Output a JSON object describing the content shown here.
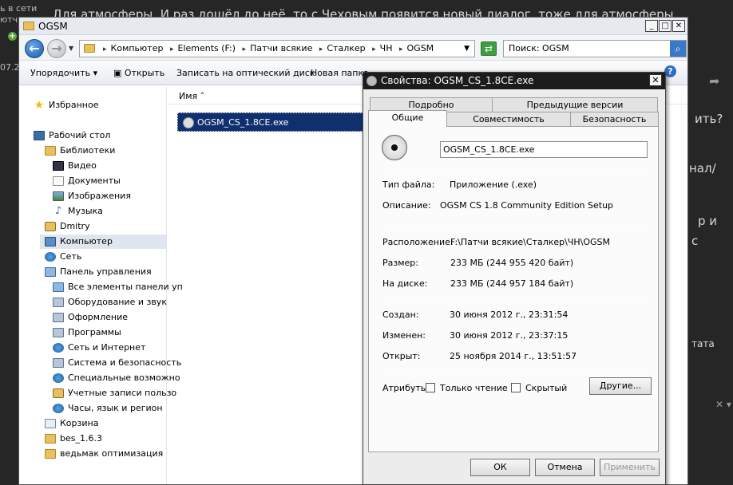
{
  "background": {
    "title": "Для атмосферы. И раз дошёл до неё, то с Чеховым появится новый диалог, тоже для атмосферы",
    "left_line1": "ь в сети",
    "left_line2": "ютч",
    "left_line3": "07.2",
    "right_line1": "ить?",
    "right_line2": "нал/",
    "right_line3": "р и",
    "right_line4": "с",
    "right_line5": "тата"
  },
  "explorer": {
    "title": "OGSM",
    "breadcrumbs": [
      "Компьютер",
      "Elements (F:)",
      "Патчи всякие",
      "Сталкер",
      "ЧН",
      "OGSM"
    ],
    "search_placeholder": "Поиск: OGSM",
    "toolbar": {
      "organize": "Упорядочить",
      "open": "Открыть",
      "burn": "Записать на оптический диск",
      "new_folder": "Новая папка"
    },
    "column_name": "Имя",
    "selected_file": "OGSM_CS_1.8CE.exe",
    "sidebar": [
      {
        "label": "Избранное",
        "icon": "star-icon"
      },
      {
        "label": "Рабочий стол",
        "icon": "desktop-icon"
      },
      {
        "label": "Библиотеки",
        "icon": "library-icon"
      },
      {
        "label": "Видео",
        "icon": "video-icon"
      },
      {
        "label": "Документы",
        "icon": "documents-icon"
      },
      {
        "label": "Изображения",
        "icon": "pictures-icon"
      },
      {
        "label": "Музыка",
        "icon": "music-icon"
      },
      {
        "label": "Dmitry",
        "icon": "user-folder-icon"
      },
      {
        "label": "Компьютер",
        "icon": "computer-icon"
      },
      {
        "label": "Сеть",
        "icon": "network-icon"
      },
      {
        "label": "Панель управления",
        "icon": "control-panel-icon"
      },
      {
        "label": "Все элементы панели уп",
        "icon": "control-panel-icon"
      },
      {
        "label": "Оборудование и звук",
        "icon": "hardware-icon"
      },
      {
        "label": "Оформление",
        "icon": "appearance-icon"
      },
      {
        "label": "Программы",
        "icon": "programs-icon"
      },
      {
        "label": "Сеть и Интернет",
        "icon": "network-internet-icon"
      },
      {
        "label": "Система и безопасность",
        "icon": "system-security-icon"
      },
      {
        "label": "Специальные возможно",
        "icon": "accessibility-icon"
      },
      {
        "label": "Учетные записи пользо",
        "icon": "user-accounts-icon"
      },
      {
        "label": "Часы, язык и регион",
        "icon": "clock-region-icon"
      },
      {
        "label": "Корзина",
        "icon": "recycle-bin-icon"
      },
      {
        "label": "bes_1.6.3",
        "icon": "folder-icon"
      },
      {
        "label": "ведьмак оптимизация",
        "icon": "folder-icon"
      }
    ]
  },
  "dialog": {
    "title": "Свойства: OGSM_CS_1.8CE.exe",
    "tabs": {
      "details": "Подробно",
      "previous": "Предыдущие версии",
      "general": "Общие",
      "compat": "Совместимость",
      "security": "Безопасность"
    },
    "file_name": "OGSM_CS_1.8CE.exe",
    "type_label": "Тип файла:",
    "type_value": "Приложение (.exe)",
    "desc_label": "Описание:",
    "desc_value": "OGSM CS 1.8 Community Edition Setup",
    "location_label": "Расположение:",
    "location_value": "F:\\Патчи всякие\\Сталкер\\ЧН\\OGSM",
    "size_label": "Размер:",
    "size_value": "233 МБ (244 955 420 байт)",
    "disk_label": "На диске:",
    "disk_value": "233 МБ (244 957 184 байт)",
    "created_label": "Создан:",
    "created_value": "30 июня 2012 г., 23:31:54",
    "modified_label": "Изменен:",
    "modified_value": "30 июня 2012 г., 23:37:15",
    "opened_label": "Открыт:",
    "opened_value": "25 ноября 2014 г., 13:51:57",
    "attrs_label": "Атрибуты:",
    "readonly_label": "Только чтение",
    "hidden_label": "Скрытый",
    "other_button": "Другие...",
    "ok": "ОК",
    "cancel": "Отмена",
    "apply": "Применить"
  }
}
